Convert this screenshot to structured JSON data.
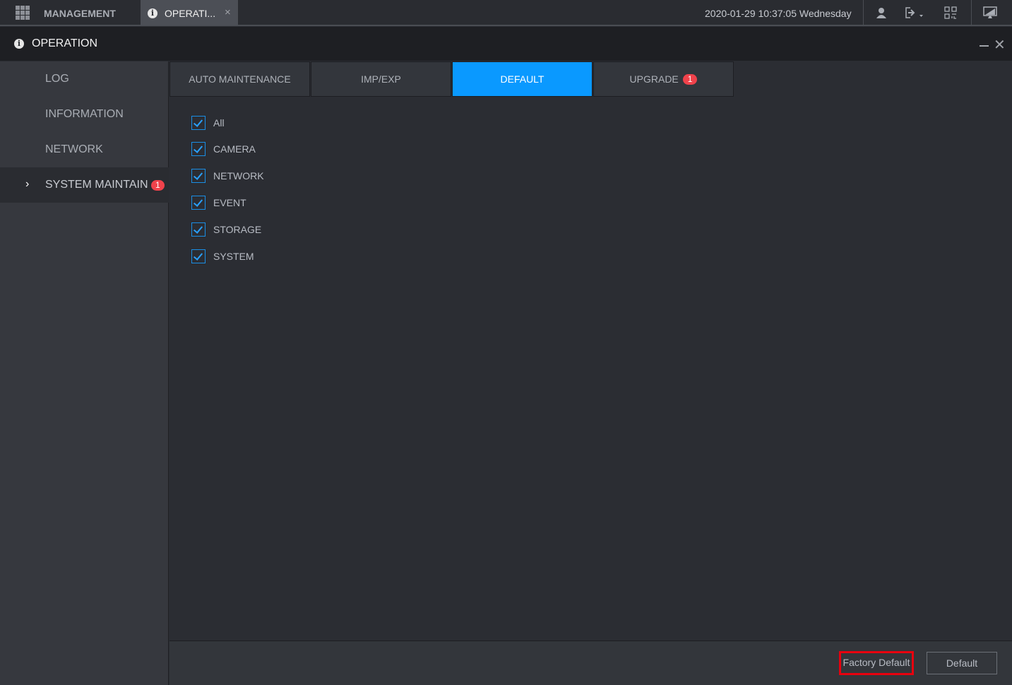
{
  "topbar": {
    "management_label": "MANAGEMENT",
    "open_tab_label": "OPERATI...",
    "close_glyph": "×",
    "datetime": "2020-01-29 10:37:05 Wednesday",
    "icons": [
      "grid-icon",
      "user-icon",
      "logout-icon",
      "qr-code-icon",
      "display-icon"
    ]
  },
  "window": {
    "title": "OPERATION",
    "info_glyph": "i",
    "close_glyph": "✕"
  },
  "sidebar": {
    "items": [
      {
        "label": "LOG"
      },
      {
        "label": "INFORMATION"
      },
      {
        "label": "NETWORK"
      },
      {
        "label": "SYSTEM MAINTAIN",
        "badge": "1",
        "active": true
      }
    ],
    "chevron": "›"
  },
  "tabs": [
    {
      "label": "AUTO MAINTENANCE"
    },
    {
      "label": "IMP/EXP"
    },
    {
      "label": "DEFAULT",
      "active": true
    },
    {
      "label": "UPGRADE",
      "badge": "1"
    }
  ],
  "checkboxes": [
    {
      "label": "All",
      "checked": true
    },
    {
      "label": "CAMERA",
      "checked": true
    },
    {
      "label": "NETWORK",
      "checked": true
    },
    {
      "label": "EVENT",
      "checked": true
    },
    {
      "label": "STORAGE",
      "checked": true
    },
    {
      "label": "SYSTEM",
      "checked": true
    }
  ],
  "footer": {
    "factory_default_label": "Factory Default",
    "default_label": "Default"
  },
  "colors": {
    "accent": "#0a99ff",
    "badge": "#f0424b",
    "highlight": "#e8000e"
  }
}
